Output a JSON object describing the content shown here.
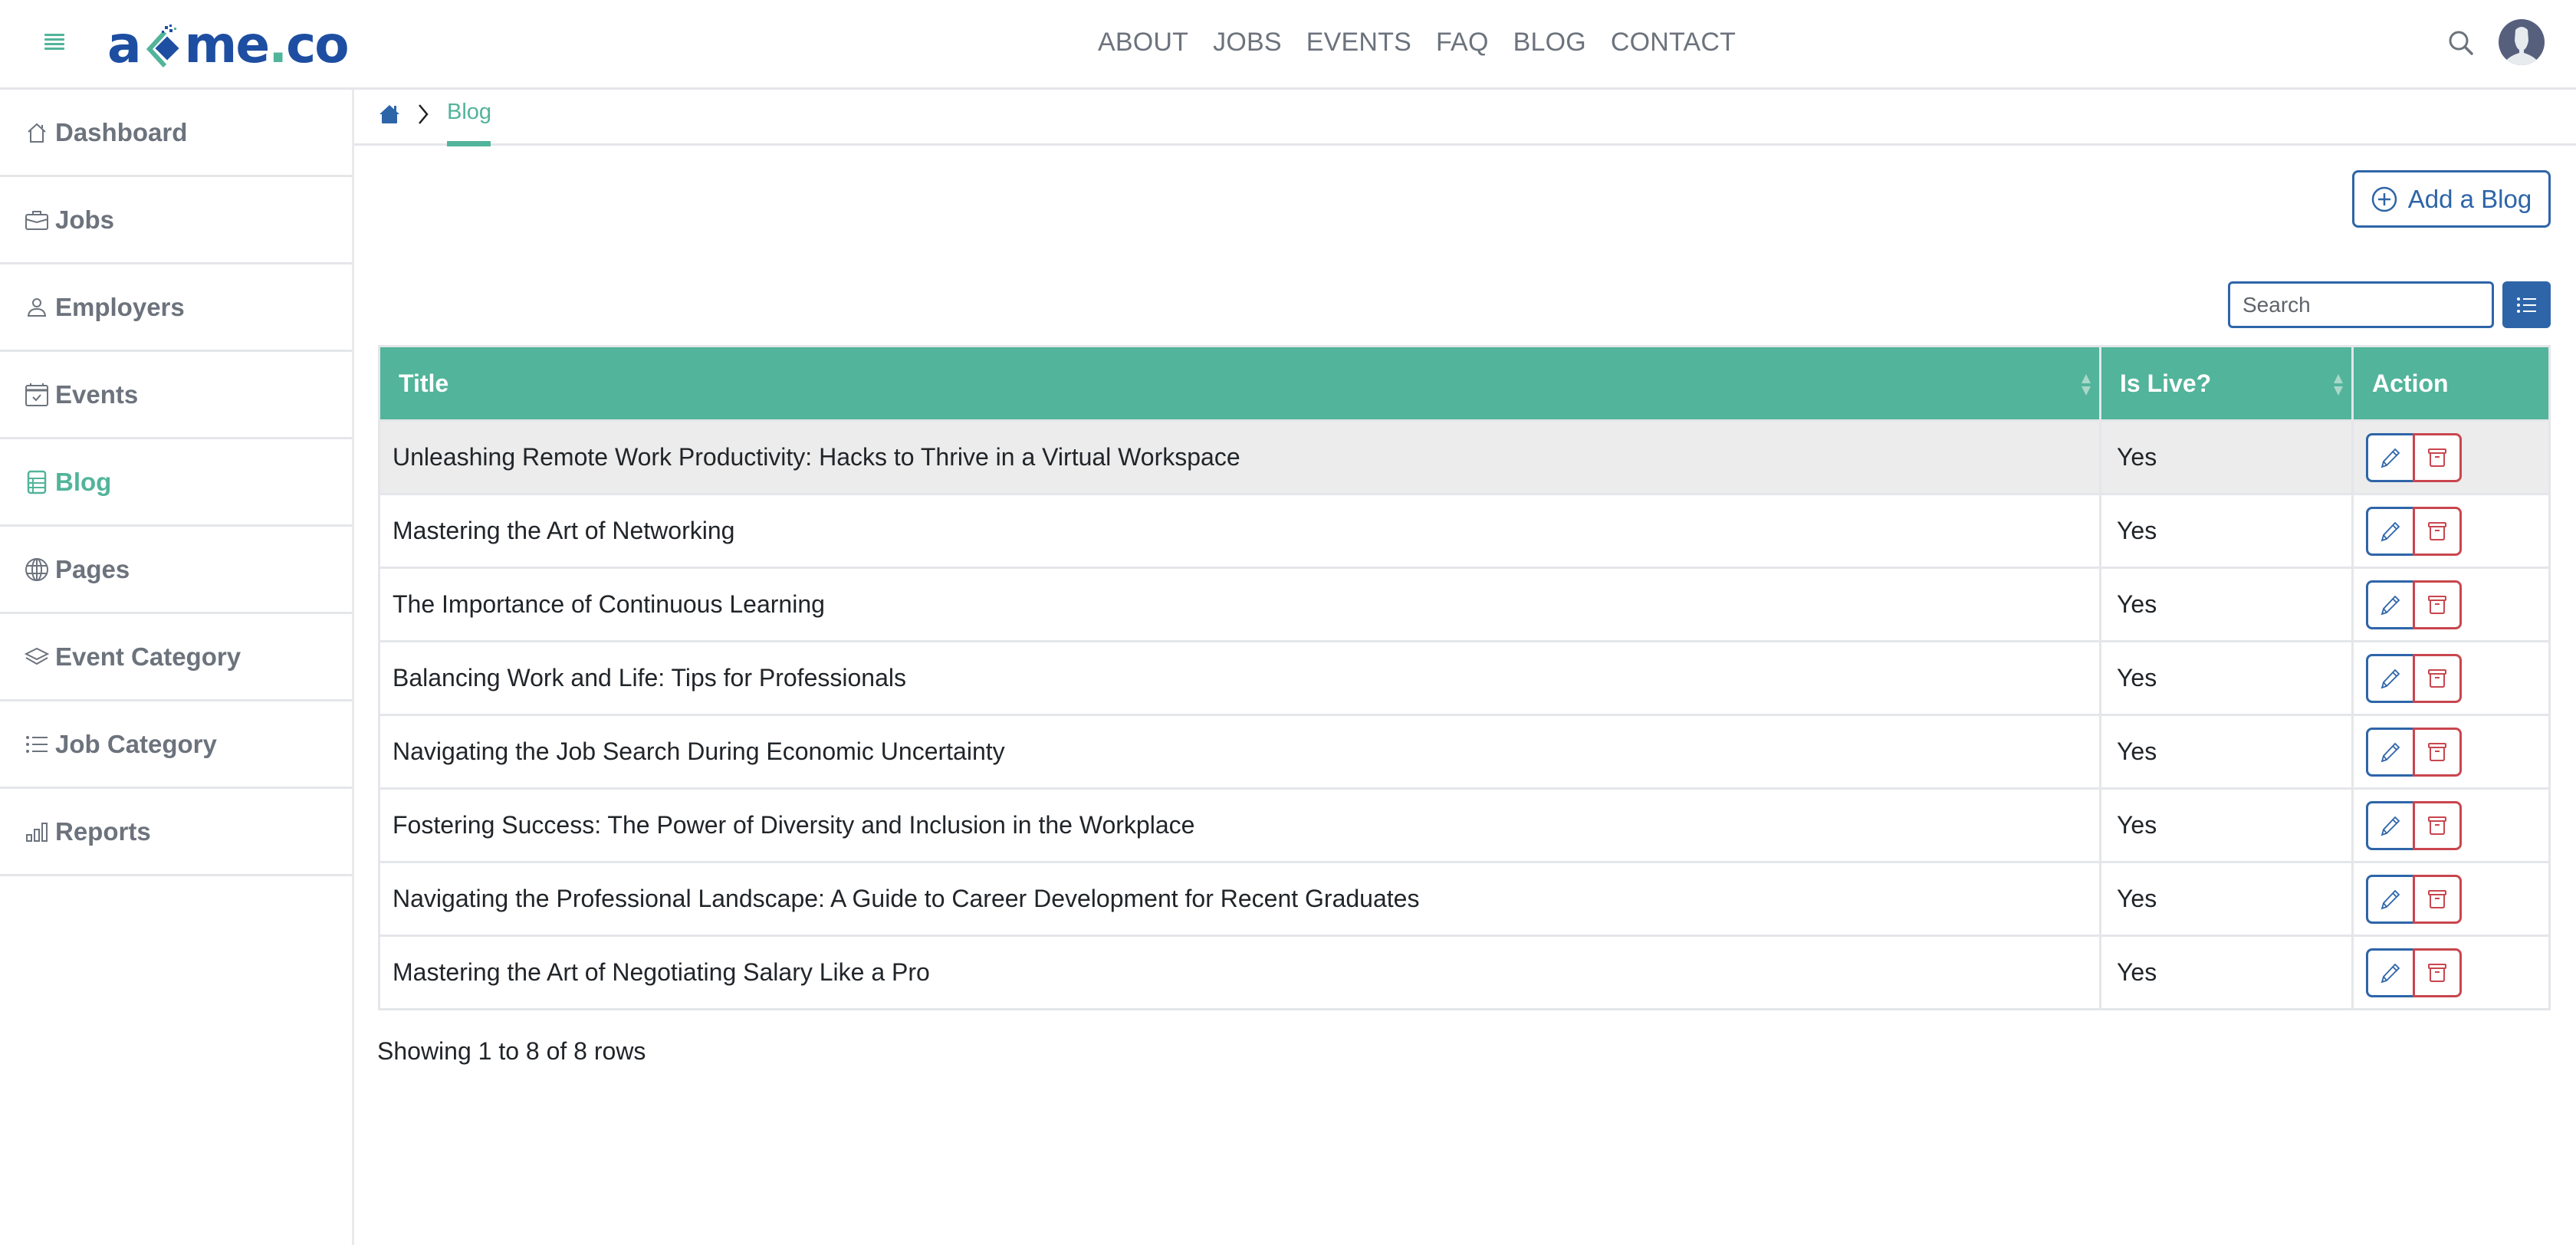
{
  "header": {
    "logo_text_a": "a",
    "logo_text_me": "me",
    "logo_text_dot": ".",
    "logo_text_co": "co",
    "nav": [
      "ABOUT",
      "JOBS",
      "EVENTS",
      "FAQ",
      "BLOG",
      "CONTACT"
    ]
  },
  "sidebar": {
    "items": [
      {
        "label": "Dashboard",
        "icon": "house-icon"
      },
      {
        "label": "Jobs",
        "icon": "briefcase-icon"
      },
      {
        "label": "Employers",
        "icon": "person-icon"
      },
      {
        "label": "Events",
        "icon": "calendar-check-icon"
      },
      {
        "label": "Blog",
        "icon": "table-icon",
        "active": true
      },
      {
        "label": "Pages",
        "icon": "globe-icon"
      },
      {
        "label": "Event Category",
        "icon": "layers-icon"
      },
      {
        "label": "Job Category",
        "icon": "list-icon"
      },
      {
        "label": "Reports",
        "icon": "bar-chart-icon"
      }
    ]
  },
  "breadcrumb": {
    "current": "Blog"
  },
  "toolbar": {
    "add_label": "Add a Blog",
    "search_placeholder": "Search",
    "search_value": ""
  },
  "table": {
    "columns": [
      "Title",
      "Is Live?",
      "Action"
    ],
    "rows": [
      {
        "title": "Unleashing Remote Work Productivity: Hacks to Thrive in a Virtual Workspace",
        "live": "Yes"
      },
      {
        "title": "Mastering the Art of Networking",
        "live": "Yes"
      },
      {
        "title": "The Importance of Continuous Learning",
        "live": "Yes"
      },
      {
        "title": "Balancing Work and Life: Tips for Professionals",
        "live": "Yes"
      },
      {
        "title": "Navigating the Job Search During Economic Uncertainty",
        "live": "Yes"
      },
      {
        "title": "Fostering Success: The Power of Diversity and Inclusion in the Workplace",
        "live": "Yes"
      },
      {
        "title": "Navigating the Professional Landscape: A Guide to Career Development for Recent Graduates",
        "live": "Yes"
      },
      {
        "title": "Mastering the Art of Negotiating Salary Like a Pro",
        "live": "Yes"
      }
    ],
    "footer": "Showing 1 to 8 of 8 rows"
  },
  "colors": {
    "brand_green": "#52b49a",
    "brand_blue": "#2e65a8",
    "logo_blue": "#1e4ea1",
    "danger_red": "#c9464e",
    "nav_gray": "#6c737d"
  }
}
